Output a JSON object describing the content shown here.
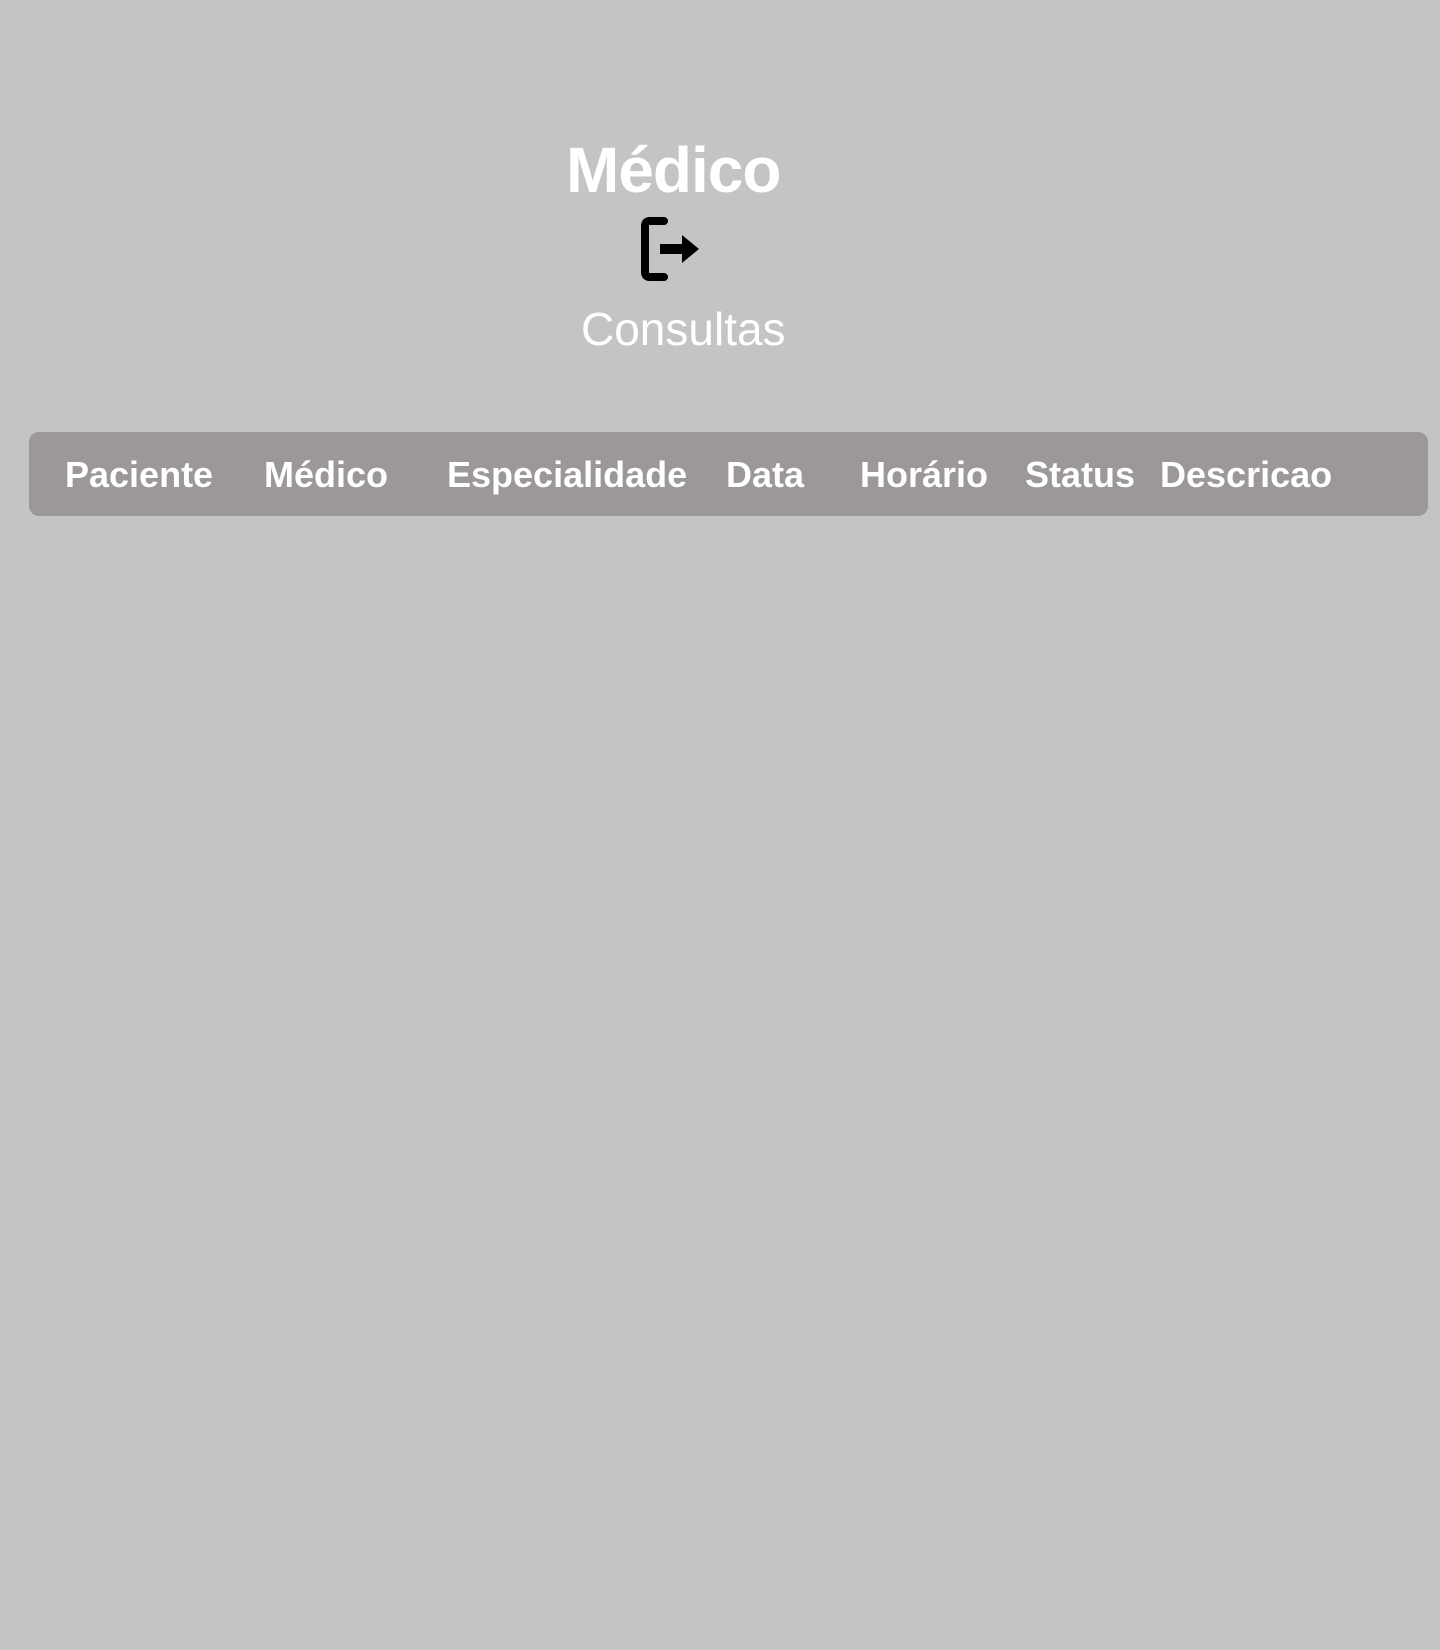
{
  "header": {
    "title": "Médico",
    "logout_icon": "logout-icon",
    "subtitle": "Consultas"
  },
  "table": {
    "columns": [
      "Paciente",
      "Médico",
      "Especialidade",
      "Data",
      "Horário",
      "Status",
      "Descricao"
    ],
    "rows": []
  },
  "colors": {
    "background": "#c4c4c4",
    "header_bar": "#9c9897",
    "text": "#ffffff",
    "icon": "#000000"
  }
}
